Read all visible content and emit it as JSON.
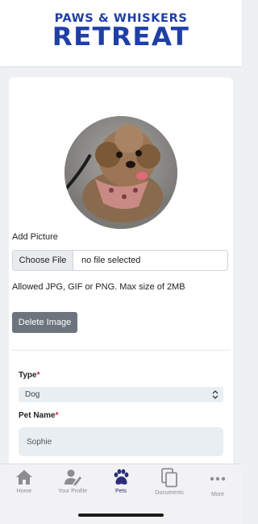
{
  "brand": {
    "line1": "PAWS & WHISKERS",
    "line2": "RETREAT",
    "color": "#1f3fa6"
  },
  "form": {
    "add_picture_label": "Add Picture",
    "file_button_label": "Choose File",
    "file_status": "no file selected",
    "allowed_text": "Allowed JPG, GIF or PNG. Max size of 2MB",
    "delete_button_label": "Delete Image",
    "type_label": "Type",
    "type_value": "Dog",
    "pet_name_label": "Pet Name",
    "pet_name_value": "Sophie",
    "required_mark": "*"
  },
  "nav": {
    "items": [
      {
        "label": "Home",
        "icon": "home-icon"
      },
      {
        "label": "Your Profile",
        "icon": "profile-icon"
      },
      {
        "label": "Pets",
        "icon": "paw-icon",
        "active": true
      },
      {
        "label": "Documents",
        "icon": "documents-icon"
      },
      {
        "label": "More",
        "icon": "more-icon"
      }
    ],
    "active_color": "#2b2d7a",
    "inactive_color": "#8c8c92"
  }
}
